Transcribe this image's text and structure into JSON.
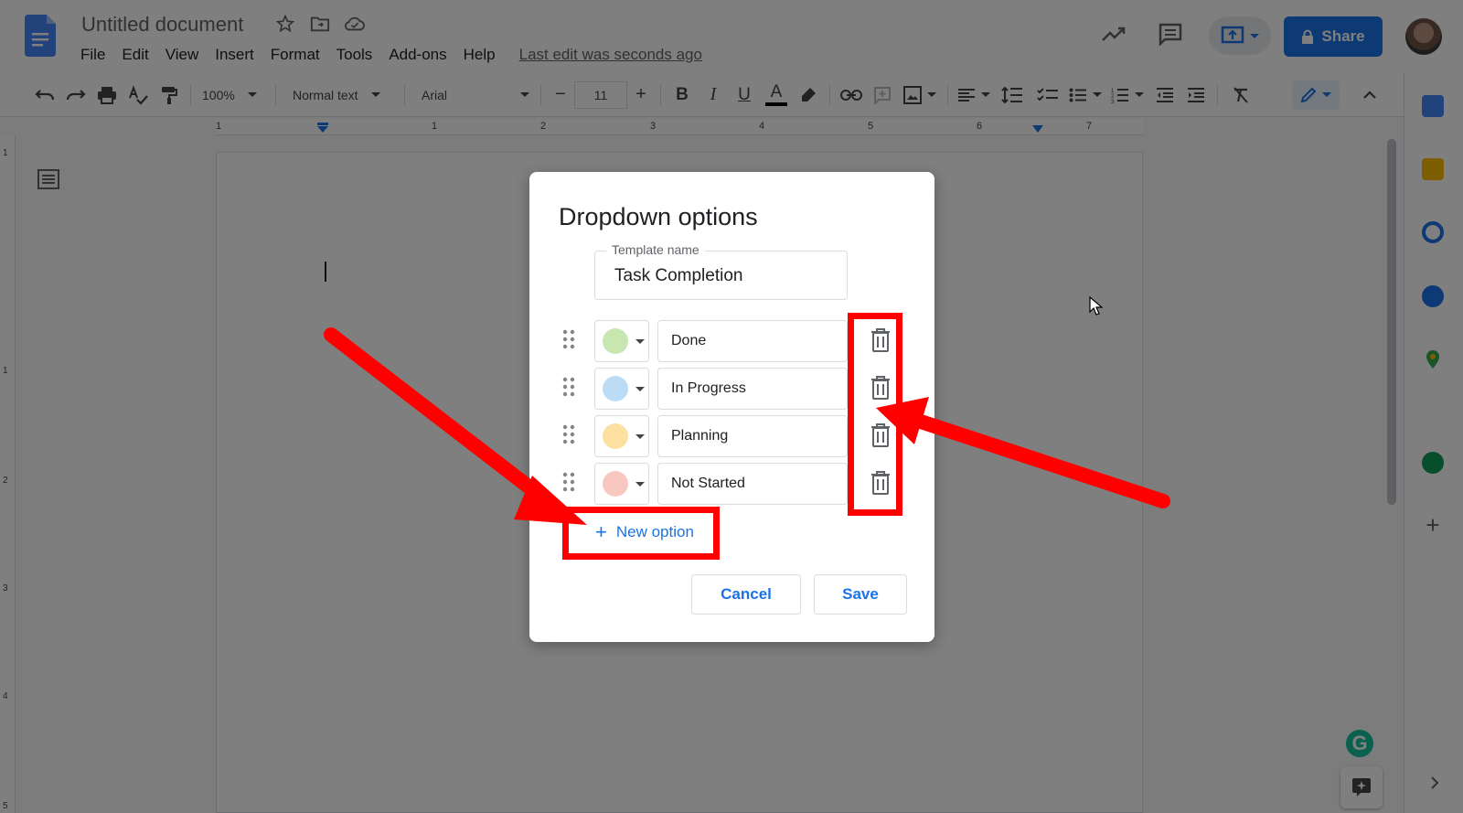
{
  "document": {
    "title": "Untitled document",
    "last_edit": "Last edit was seconds ago"
  },
  "menu": {
    "items": [
      "File",
      "Edit",
      "View",
      "Insert",
      "Format",
      "Tools",
      "Add-ons",
      "Help"
    ]
  },
  "header": {
    "share_label": "Share"
  },
  "toolbar": {
    "zoom": "100%",
    "style": "Normal text",
    "font": "Arial",
    "font_size": "11",
    "bold": "B",
    "italic": "I",
    "underline": "U",
    "text_color_glyph": "A"
  },
  "ruler": {
    "ticks": [
      "1",
      "1",
      "2",
      "3",
      "4",
      "5",
      "6",
      "7"
    ],
    "left_ticks": [
      "1",
      "1",
      "2",
      "3",
      "4",
      "5"
    ]
  },
  "dialog": {
    "title": "Dropdown options",
    "template_label": "Template name",
    "template_value": "Task Completion",
    "options": [
      {
        "label": "Done",
        "color": "#c8e6b0"
      },
      {
        "label": "In Progress",
        "color": "#bcdcf5"
      },
      {
        "label": "Planning",
        "color": "#fde0a0"
      },
      {
        "label": "Not Started",
        "color": "#f8c8c0"
      }
    ],
    "new_option_label": "New option",
    "cancel_label": "Cancel",
    "save_label": "Save"
  },
  "colors": {
    "accent": "#1a73e8",
    "annotation": "#ff0000"
  },
  "side_panel": {
    "icons": [
      "calendar-icon",
      "keep-icon",
      "tasks-icon",
      "contacts-icon",
      "maps-icon",
      "addon-icon",
      "add-icon"
    ]
  }
}
